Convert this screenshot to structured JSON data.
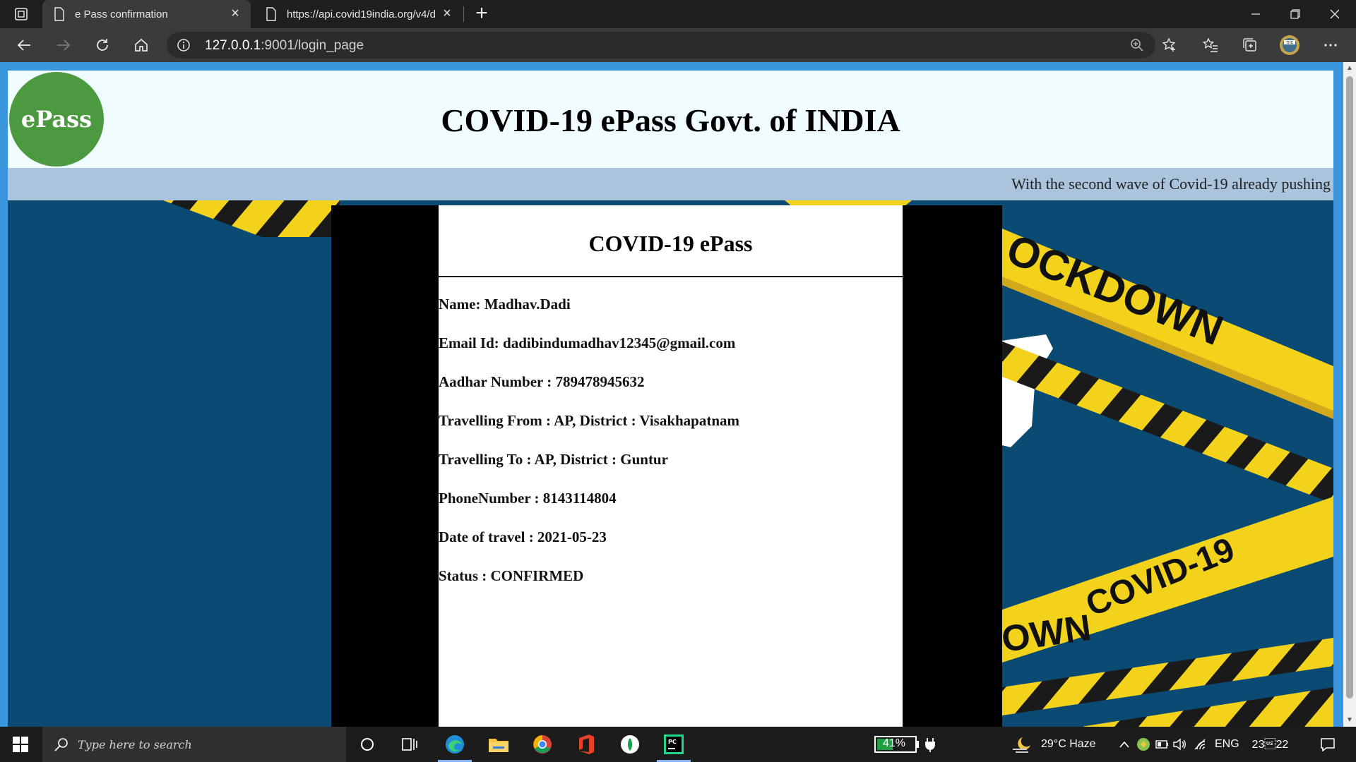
{
  "browser": {
    "tabs": [
      {
        "title": "e Pass confirmation",
        "active": true
      },
      {
        "title": "https://api.covid19india.org/v4/d",
        "active": false
      }
    ],
    "url_host": "127.0.0.1",
    "url_rest": ":9001/login_page"
  },
  "page": {
    "logo_text": "ePass",
    "site_title": "COVID-19 ePass Govt. of INDIA",
    "marquee": "With the second wave of Covid-19 already pushing",
    "bg_banners": {
      "top": "OCKDOWN",
      "bottom": "COVID-19",
      "bottom2": "OWN"
    },
    "card": {
      "title": "COVID-19 ePass",
      "fields": [
        "Name: Madhav.Dadi",
        "Email Id: dadibindumadhav12345@gmail.com",
        "Aadhar Number : 789478945632",
        "Travelling From : AP, District : Visakhapatnam",
        "Travelling To : AP, District : Guntur",
        "PhoneNumber : 8143114804",
        "Date of travel : 2021-05-23",
        "Status : CONFIRMED"
      ]
    }
  },
  "taskbar": {
    "search_placeholder": "Type here to search",
    "battery": "41%",
    "weather": "29°C  Haze",
    "language": "ENG",
    "time": "23\u001f22"
  },
  "colors": {
    "brand_green": "#4c9a3f",
    "header_bg": "#f0fcff",
    "marquee_bg": "#a9c4dc",
    "page_bg": "#0b4a72",
    "tape_yellow": "#f2d21b"
  }
}
